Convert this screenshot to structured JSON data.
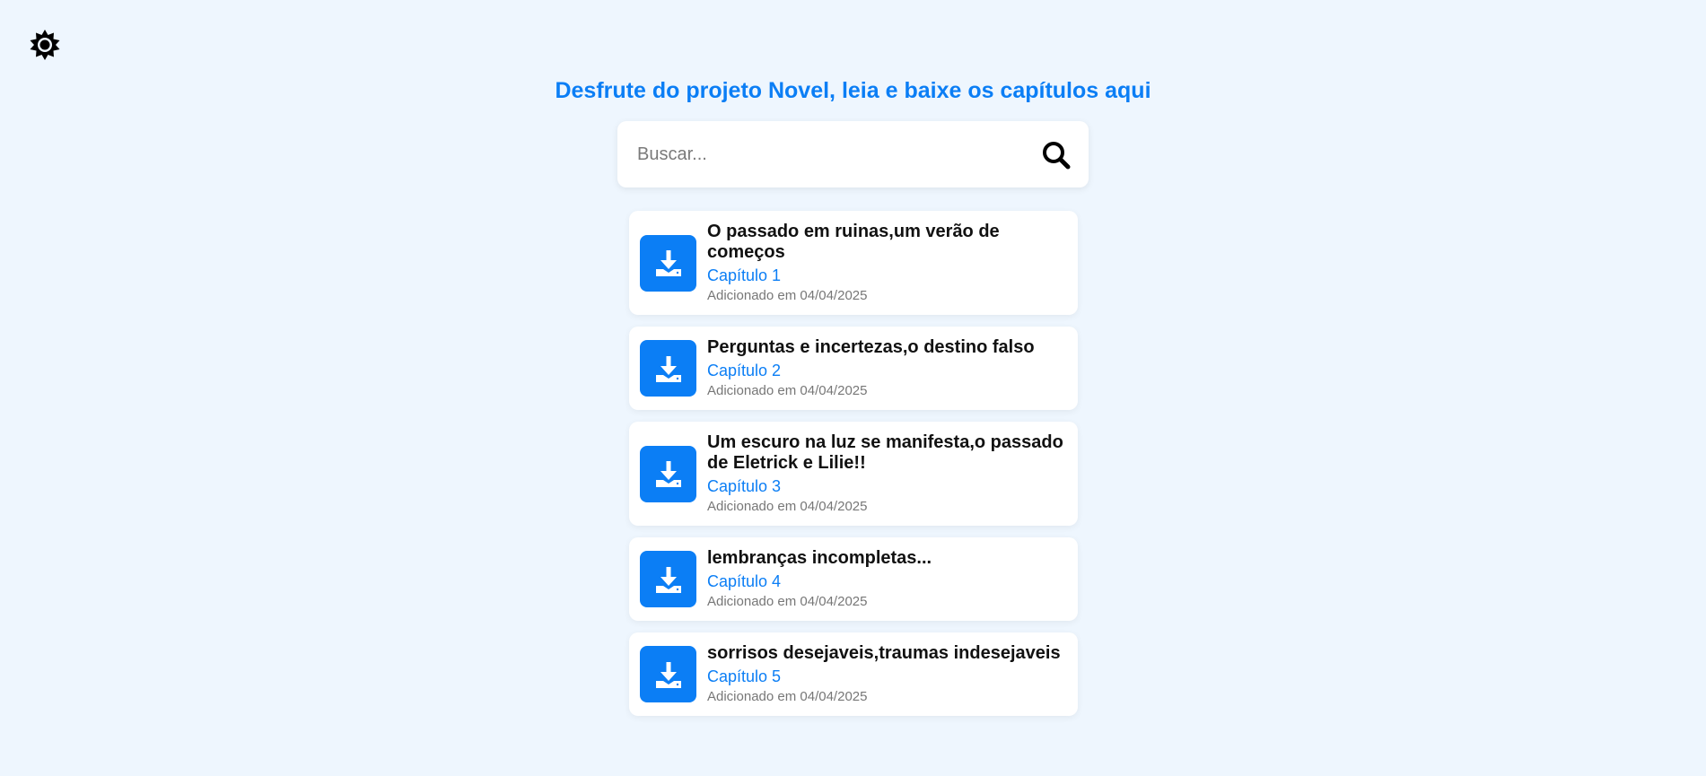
{
  "theme_toggle": {
    "icon": "sun-gear-icon"
  },
  "header": {
    "title": "Desfrute do projeto Novel, leia e baixe os capítulos aqui"
  },
  "search": {
    "placeholder": "Buscar...",
    "value": "",
    "icon": "search-icon"
  },
  "colors": {
    "accent": "#0b7ef5",
    "background": "#eef6fe"
  },
  "chapters": [
    {
      "title": "O passado em ruinas,um verão de começos",
      "chapter": "Capítulo 1",
      "added": "Adicionado em 04/04/2025",
      "icon": "download-icon"
    },
    {
      "title": "Perguntas e incertezas,o destino falso",
      "chapter": "Capítulo 2",
      "added": "Adicionado em 04/04/2025",
      "icon": "download-icon"
    },
    {
      "title": "Um escuro na luz se manifesta,o passado de Eletrick e Lilie!!",
      "chapter": "Capítulo 3",
      "added": "Adicionado em 04/04/2025",
      "icon": "download-icon"
    },
    {
      "title": "lembranças incompletas...",
      "chapter": "Capítulo 4",
      "added": "Adicionado em 04/04/2025",
      "icon": "download-icon"
    },
    {
      "title": "sorrisos desejaveis,traumas indesejaveis",
      "chapter": "Capítulo 5",
      "added": "Adicionado em 04/04/2025",
      "icon": "download-icon"
    }
  ]
}
